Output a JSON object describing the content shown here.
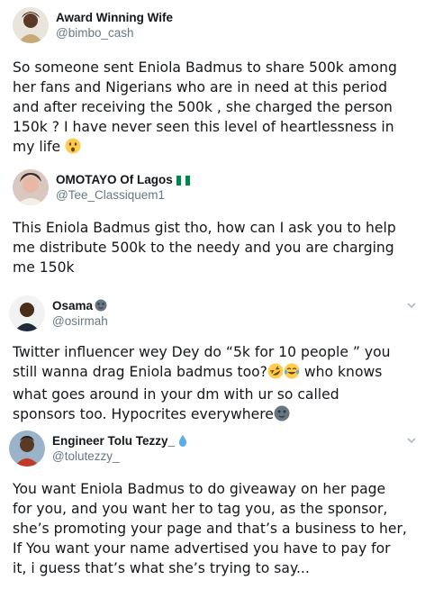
{
  "tweets": [
    {
      "name": "Award Winning Wife",
      "handle": "@bimbo_cash",
      "lines": [
        "So someone sent Eniola Badmus to share 500k among",
        "her fans and Nigerians who are in need at this period",
        "and after receiving the 500k , she charged the person",
        "150k ? I have never seen this level of heartlessness in",
        "my life"
      ],
      "emoji": "astonished-face"
    },
    {
      "name": "OMOTAYO Of Lagos",
      "handle": "@Tee_Classiquem1",
      "badge": "nigeria-flag",
      "lines": [
        "This Eniola Badmus gist tho, how can I ask you to help",
        "me distribute 500k to the needy and you are charging",
        "me 150k"
      ]
    },
    {
      "name": "Osama",
      "handle": "@osirmah",
      "badge": "new-moon-face",
      "lines": [
        "Twitter influencer wey Dey do “5k for 10 people ” you",
        "still wanna drag Eniola badmus too?",
        " who knows",
        "what goes around in your dm with ur so called",
        "sponsors too. Hypocrites everywhere"
      ],
      "emojis": [
        "rolling-on-floor-laughing",
        "tears-of-joy",
        "new-moon-face"
      ]
    },
    {
      "name": "Engineer Tolu Tezzy_",
      "handle": "@tolutezzy_",
      "badge": "droplet",
      "lines": [
        "You want Eniola Badmus to do giveaway on her page",
        "for you, and you want her to tag you, as the sponsor,",
        "she’s promoting your page and that’s a business to her,",
        "If You want your name advertised you have to pay for",
        "it, i guess that’s what she’s trying to say..."
      ]
    }
  ],
  "colors": {
    "text": "#14171a",
    "secondary": "#657786",
    "chevron": "#aab8c2"
  }
}
